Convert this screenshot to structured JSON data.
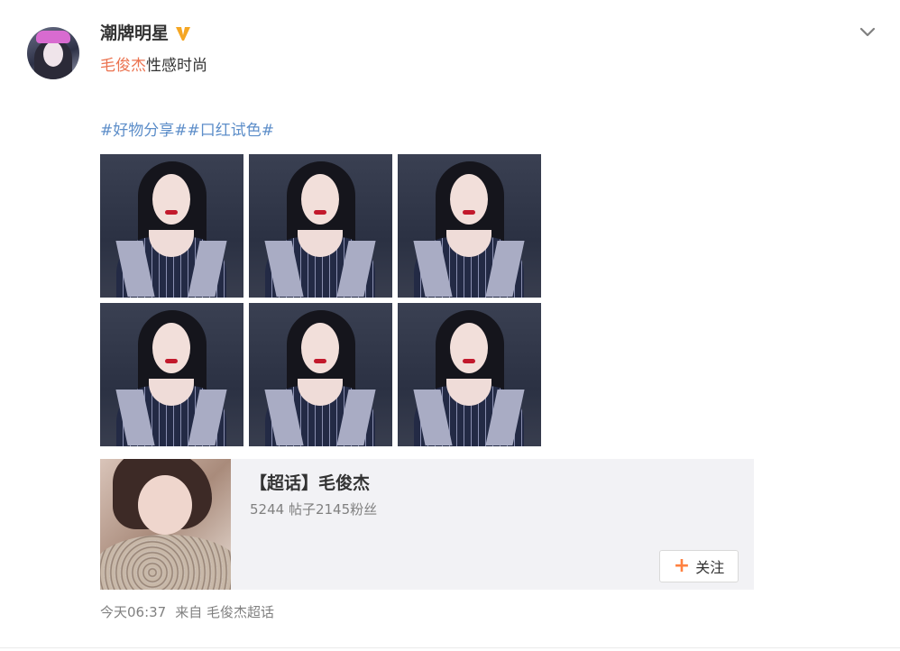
{
  "post": {
    "author_name": "潮牌明星",
    "author_verified_icon": "verified-badge-icon",
    "text_mention": "毛俊杰",
    "text_rest": "性感时尚",
    "hashtags": "#好物分享##口红试色#",
    "timestamp": "今天06:37",
    "source_prefix": "来自",
    "source_name": "毛俊杰超话",
    "menu_icon": "chevron-down-icon"
  },
  "photos": [
    {
      "name": "photo-1"
    },
    {
      "name": "photo-2"
    },
    {
      "name": "photo-3"
    },
    {
      "name": "photo-4"
    },
    {
      "name": "photo-5"
    },
    {
      "name": "photo-6"
    }
  ],
  "topic_card": {
    "title": "【超话】毛俊杰",
    "stats": "5244 帖子2145粉丝",
    "follow_label": "关注",
    "follow_icon": "plus-icon"
  },
  "colors": {
    "mention": "#eb7350",
    "hashtag": "#5d8ec9",
    "verified": "#f5a623",
    "follow_plus": "#ff8140",
    "card_bg": "#f2f2f5"
  }
}
